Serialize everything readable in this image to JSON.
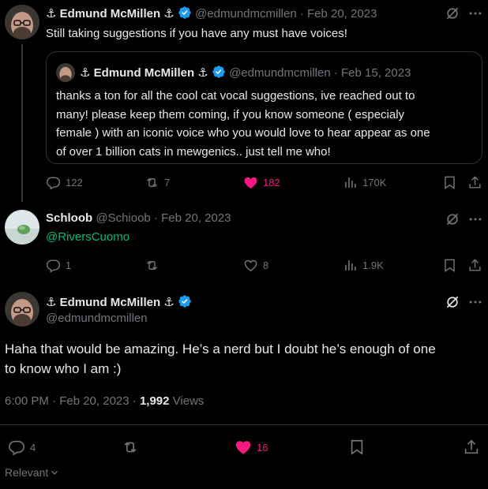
{
  "tweet1": {
    "display_name": "⚓ Edmund McMillen ⚓",
    "handle": "@edmundmcmillen",
    "date": "· Feb 20, 2023",
    "text": "Still taking suggestions if you have any must have voices!",
    "quote": {
      "display_name": "⚓ Edmund McMillen ⚓",
      "handle": "@edmundmcmillen",
      "date": "· Feb 15, 2023",
      "lines": [
        "thanks a ton for all the cool cat vocal suggestions, ive reached out to",
        "many! please keep them coming, if you know someone ( especialy",
        "female ) with an iconic voice who you would love to hear appear as one",
        "of over 1 billion cats in mewgenics.. just tell me who!"
      ]
    },
    "metrics": {
      "replies": "122",
      "reposts": "7",
      "likes": "182",
      "views": "170K"
    }
  },
  "tweet2": {
    "display_name": "Schloob",
    "handle": "@Schioob",
    "date": "· Feb 20, 2023",
    "text": "@RiversCuomo",
    "metrics": {
      "replies": "1",
      "reposts": "",
      "likes": "8",
      "views": "1.9K"
    }
  },
  "main_tweet": {
    "display_name": "⚓ Edmund McMillen ⚓",
    "handle": "@edmundmcmillen",
    "lines": [
      "Haha that would be amazing. He’s a nerd but I doubt he’s enough of one",
      "to know who I am :)"
    ],
    "timestamp": "6:00 PM · Feb 20, 2023 ·",
    "views_count": "1,992",
    "views_label": "Views",
    "metrics": {
      "replies": "4",
      "likes": "16"
    }
  },
  "footer": {
    "sort_label": "Relevant"
  },
  "colors": {
    "accent": "#1d9bf0",
    "like": "#f91880",
    "link": "#1d9bf0",
    "mention": "#00ba7c"
  }
}
